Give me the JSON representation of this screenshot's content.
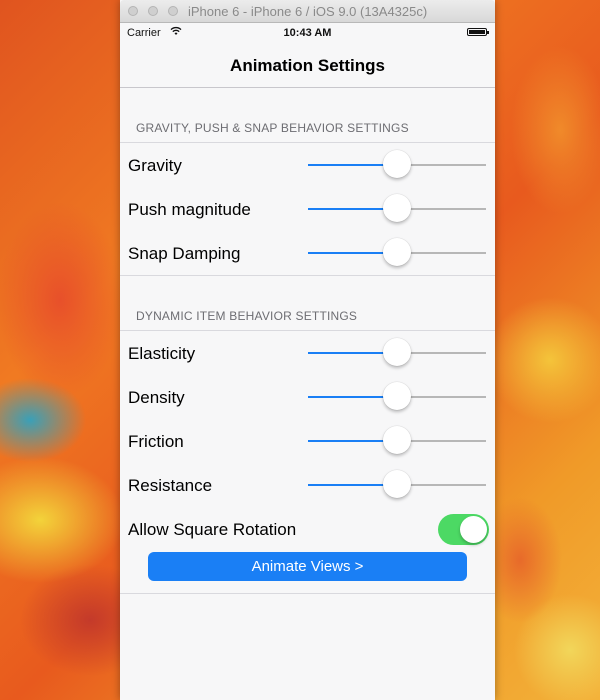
{
  "simulator": {
    "title": "iPhone 6 - iPhone 6 / iOS 9.0 (13A4325c)"
  },
  "status_bar": {
    "carrier": "Carrier",
    "time": "10:43 AM",
    "wifi_icon": "wifi-icon",
    "battery_icon": "battery-icon"
  },
  "nav": {
    "title": "Animation Settings"
  },
  "sections": [
    {
      "header": "GRAVITY, PUSH & SNAP BEHAVIOR SETTINGS",
      "sliders": [
        {
          "label": "Gravity",
          "value": 0.5
        },
        {
          "label": "Push magnitude",
          "value": 0.5
        },
        {
          "label": "Snap Damping",
          "value": 0.5
        }
      ]
    },
    {
      "header": "DYNAMIC ITEM BEHAVIOR SETTINGS",
      "sliders": [
        {
          "label": "Elasticity",
          "value": 0.5
        },
        {
          "label": "Density",
          "value": 0.5
        },
        {
          "label": "Friction",
          "value": 0.5
        },
        {
          "label": "Resistance",
          "value": 0.5
        }
      ],
      "toggle": {
        "label": "Allow Square Rotation",
        "on": true
      }
    }
  ],
  "button": {
    "label": "Animate Views >"
  },
  "colors": {
    "tint": "#1a7ff5",
    "toggle_on": "#4cd964",
    "track": "#b7b7b7"
  }
}
